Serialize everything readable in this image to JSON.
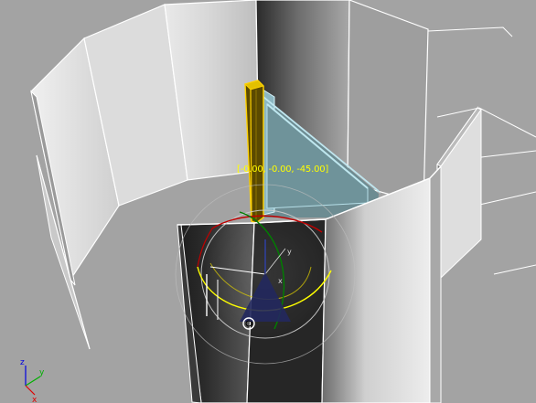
{
  "viewport": {
    "rotation_readout": "[-0.00, -0.00, -45.00]",
    "readout_color": "#ffff00"
  },
  "axis_tripod": {
    "x_label": "x",
    "y_label": "y",
    "z_label": "z",
    "x_color": "#e00000",
    "y_color": "#00b000",
    "z_color": "#0000e0"
  },
  "gizmo": {
    "type": "rotate",
    "x_axis_color": "#c00000",
    "y_axis_color": "#008000",
    "z_axis_color": "#ffff00",
    "screen_ring_color": "#c8c8c8",
    "x_label": "x",
    "y_label": "y",
    "z_label": "z"
  },
  "selection": {
    "door_frame_color": "#ffd200",
    "glass_color": "#a9dbe6"
  }
}
